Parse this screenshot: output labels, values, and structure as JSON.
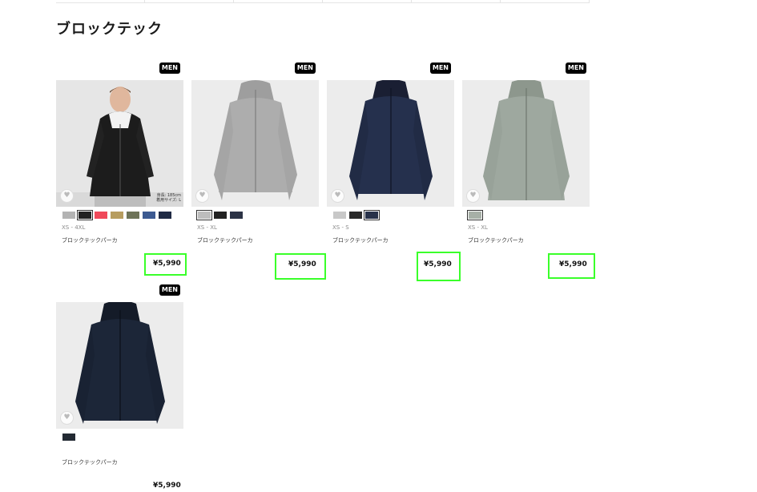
{
  "page": {
    "title": "ブロックテック"
  },
  "products": [
    {
      "badge": "MEN",
      "image": "jacket-black-model",
      "model_note_1": "身長: 185cm",
      "model_note_2": "着用サイズ: L",
      "swatches": [
        "#b3b3b3",
        "#222222",
        "#f0495a",
        "#b79d5f",
        "#6e7358",
        "#3c5a91",
        "#1f2a44"
      ],
      "selected": 1,
      "size": "XS - 4XL",
      "name": "ブロックテックパーカ",
      "price": "¥5,990"
    },
    {
      "badge": "MEN",
      "image": "jacket-light-gray",
      "swatches": [
        "#bdbdbd",
        "#222222",
        "#2c3346"
      ],
      "selected": 0,
      "size": "XS - XL",
      "name": "ブロックテックパーカ",
      "price": "¥5,990"
    },
    {
      "badge": "MEN",
      "image": "jacket-navy",
      "swatches": [
        "#c8c8c8",
        "#2a2a2a",
        "#28324a"
      ],
      "selected": 2,
      "size": "XS - S",
      "name": "ブロックテックパーカ",
      "price": "¥5,990"
    },
    {
      "badge": "MEN",
      "image": "jacket-sage-gray",
      "swatches": [
        "#a7b0a7"
      ],
      "selected": 0,
      "size": "XS - XL",
      "name": "ブロックテックパーカ",
      "price": "¥5,990"
    },
    {
      "badge": "MEN",
      "image": "jacket-dark-navy",
      "swatches": [
        "#232a33"
      ],
      "selected": -1,
      "size": "",
      "name": "ブロックテックパーカ",
      "price": "¥5,990"
    }
  ],
  "highlight_color": "#3aff2a"
}
